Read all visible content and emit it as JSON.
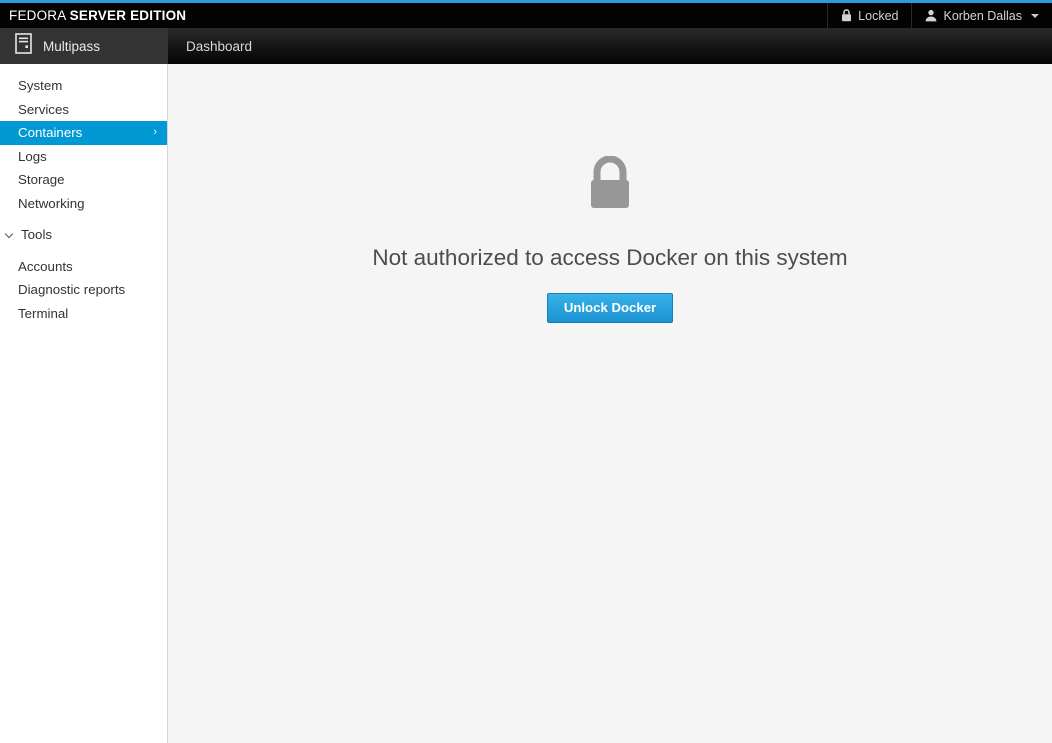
{
  "topbar": {
    "brand_light": "FEDORA",
    "brand_bold": "SERVER EDITION",
    "locked_label": "Locked",
    "locked_icon": "lock-icon",
    "user_label": "Korben Dallas",
    "user_icon": "user-icon",
    "caret_icon": "chevron-down-icon",
    "accent_color": "#2f9bdb"
  },
  "header": {
    "host_icon": "server-icon",
    "host_label": "Multipass",
    "page_title": "Dashboard"
  },
  "sidebar": {
    "items": [
      {
        "label": "System",
        "active": false
      },
      {
        "label": "Services",
        "active": false
      },
      {
        "label": "Containers",
        "active": true
      },
      {
        "label": "Logs",
        "active": false
      },
      {
        "label": "Storage",
        "active": false
      },
      {
        "label": "Networking",
        "active": false
      }
    ],
    "group": {
      "label": "Tools",
      "expanded": true,
      "chevron_icon": "chevron-down-icon",
      "items": [
        {
          "label": "Accounts"
        },
        {
          "label": "Diagnostic reports"
        },
        {
          "label": "Terminal"
        }
      ]
    },
    "active_color": "#0099d3",
    "active_chevron": "chevron-right-icon"
  },
  "main": {
    "lock_icon": "lock-icon",
    "message": "Not authorized to access Docker on this system",
    "unlock_button": "Unlock Docker",
    "button_color": "#2aa3dd"
  }
}
